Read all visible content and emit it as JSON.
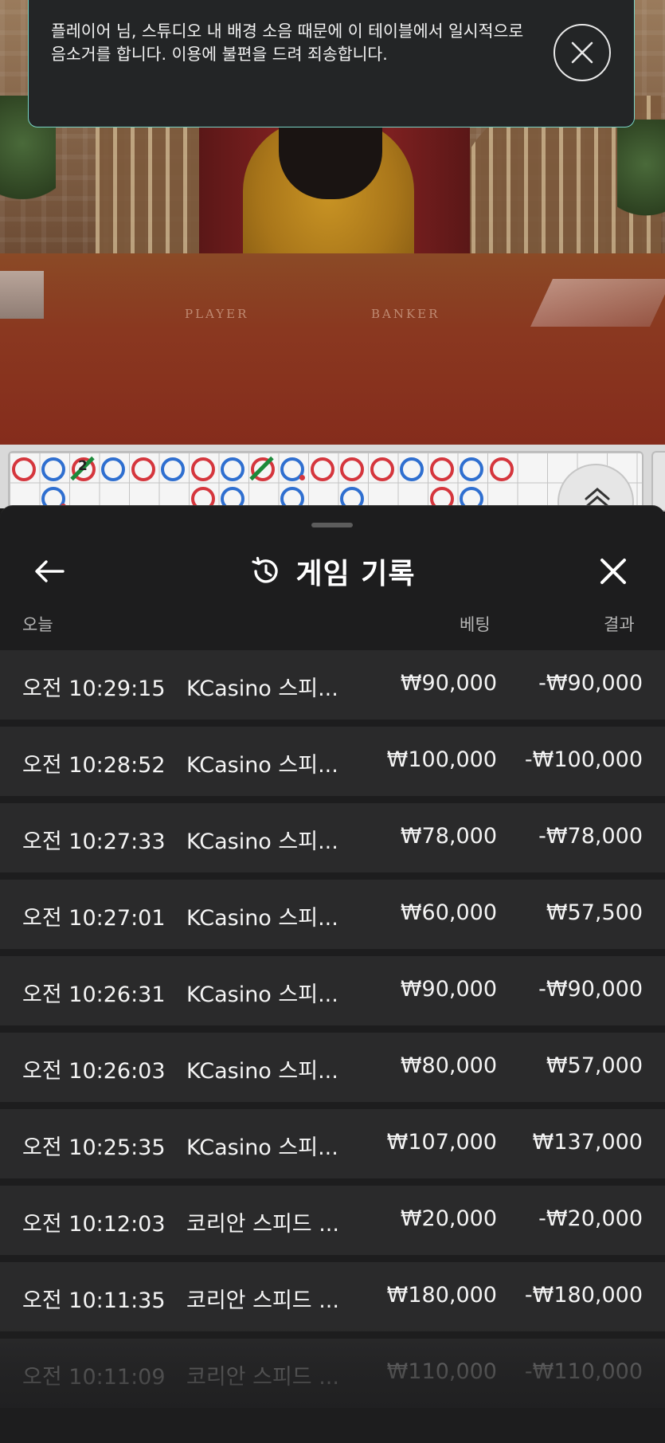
{
  "notice": {
    "message": "플레이어 님, 스튜디오 내 배경 소음 때문에 이 테이블에서 일시적으로 음소거를 합니다. 이용에 불편을 드려 죄송합니다."
  },
  "video": {
    "player_label": "PLAYER",
    "banker_label": "BANKER"
  },
  "road": {
    "tie_count": "2"
  },
  "history": {
    "title": "게임 기록",
    "columns": {
      "date": "오늘",
      "bet": "베팅",
      "result": "결과"
    },
    "rows": [
      {
        "time": "오전 10:29:15",
        "game": "KCasino 스피...",
        "bet": "₩90,000",
        "result": "-₩90,000"
      },
      {
        "time": "오전 10:28:52",
        "game": "KCasino 스피...",
        "bet": "₩100,000",
        "result": "-₩100,000"
      },
      {
        "time": "오전 10:27:33",
        "game": "KCasino 스피...",
        "bet": "₩78,000",
        "result": "-₩78,000"
      },
      {
        "time": "오전 10:27:01",
        "game": "KCasino 스피...",
        "bet": "₩60,000",
        "result": "₩57,500"
      },
      {
        "time": "오전 10:26:31",
        "game": "KCasino 스피...",
        "bet": "₩90,000",
        "result": "-₩90,000"
      },
      {
        "time": "오전 10:26:03",
        "game": "KCasino 스피...",
        "bet": "₩80,000",
        "result": "₩57,000"
      },
      {
        "time": "오전 10:25:35",
        "game": "KCasino 스피...",
        "bet": "₩107,000",
        "result": "₩137,000"
      },
      {
        "time": "오전 10:12:03",
        "game": "코리안 스피드 ...",
        "bet": "₩20,000",
        "result": "-₩20,000"
      },
      {
        "time": "오전 10:11:35",
        "game": "코리안 스피드 ...",
        "bet": "₩180,000",
        "result": "-₩180,000"
      },
      {
        "time": "오전 10:11:09",
        "game": "코리안 스피드 ...",
        "bet": "₩110,000",
        "result": "-₩110,000"
      }
    ]
  },
  "icons": {
    "close_notice": "close-circle-icon",
    "back": "arrow-left-icon",
    "history": "history-clock-icon",
    "close_sheet": "close-icon",
    "expand": "chevron-up-double-icon"
  },
  "colors": {
    "player_blue": "#2f6fd0",
    "banker_red": "#d5363d",
    "tie_green": "#1c8a3a",
    "notice_border": "#79d3c4",
    "row_bg": "#2a2a2b",
    "sheet_bg": "#1d1d1e"
  }
}
